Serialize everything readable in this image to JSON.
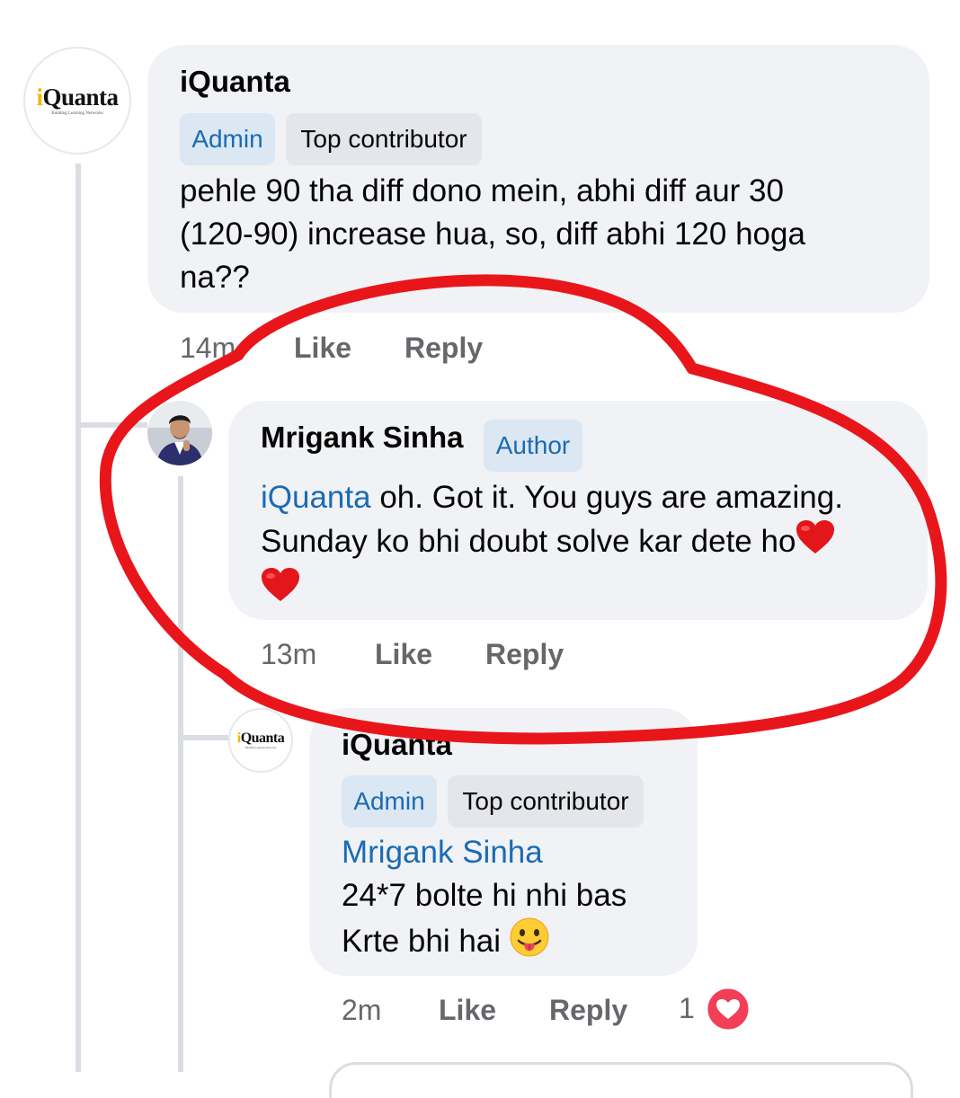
{
  "comments": [
    {
      "author": "iQuanta",
      "avatar_logo": {
        "word": "iQuanta",
        "tagline": "Building Learning Networks"
      },
      "badges": [
        "Admin",
        "Top contributor"
      ],
      "text_lines": [
        "pehle 90 tha diff dono mein, abhi diff aur 30",
        "(120-90) increase hua, so, diff abhi 120 hoga",
        "na??"
      ],
      "time": "14m",
      "like_label": "Like",
      "reply_label": "Reply"
    },
    {
      "author": "Mrigank Sinha",
      "badge": "Author",
      "mention": "iQuanta",
      "text_line1": " oh. Got it. You guys are amazing.",
      "text_line2": "Sunday ko bhi doubt solve kar dete ho",
      "time": "13m",
      "like_label": "Like",
      "reply_label": "Reply"
    },
    {
      "author": "iQuanta",
      "avatar_logo": {
        "word": "iQuanta",
        "tagline": "Building Learning Networks"
      },
      "badges": [
        "Admin",
        "Top contributor"
      ],
      "mention": "Mrigank Sinha",
      "text_line1": "24*7 bolte hi nhi bas",
      "text_line2": "Krte bhi hai",
      "time": "2m",
      "like_label": "Like",
      "reply_label": "Reply",
      "reaction_count": "1"
    }
  ],
  "colors": {
    "annotation": "#e8161b",
    "link": "#1b6bb3",
    "bubble": "#f0f2f5"
  },
  "icons": [
    "heart-emoji",
    "tongue-out-emoji",
    "love-reaction-icon"
  ]
}
